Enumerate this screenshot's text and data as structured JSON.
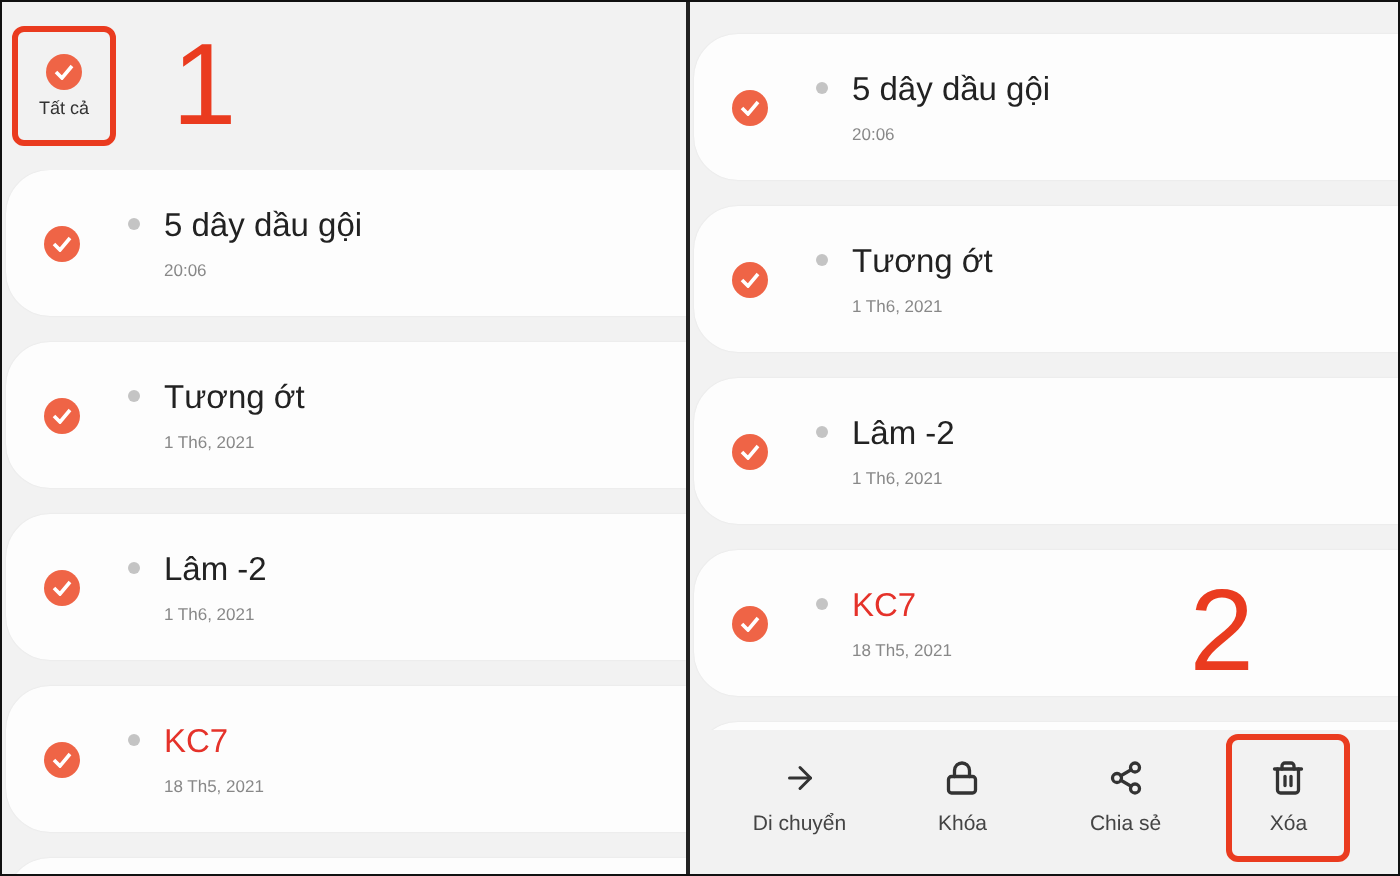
{
  "left_panel": {
    "select_all": {
      "label": "Tất cả",
      "checked": true
    },
    "step_label": "1",
    "notes": [
      {
        "title": "5 dây dầu gội",
        "date": "20:06",
        "selected": true,
        "color": "#222222"
      },
      {
        "title": "Tương ớt",
        "date": "1 Th6, 2021",
        "selected": true,
        "color": "#222222"
      },
      {
        "title": "Lâm -2",
        "date": "1 Th6, 2021",
        "selected": true,
        "color": "#222222"
      },
      {
        "title": "KC7",
        "date": "18 Th5, 2021",
        "selected": true,
        "color": "#e5322a"
      }
    ]
  },
  "right_panel": {
    "step_label": "2",
    "notes": [
      {
        "title": "5 dây dầu gội",
        "date": "20:06",
        "selected": true,
        "color": "#222222"
      },
      {
        "title": "Tương ớt",
        "date": "1 Th6, 2021",
        "selected": true,
        "color": "#222222"
      },
      {
        "title": "Lâm -2",
        "date": "1 Th6, 2021",
        "selected": true,
        "color": "#222222"
      },
      {
        "title": "KC7",
        "date": "18 Th5, 2021",
        "selected": true,
        "color": "#e5322a"
      }
    ],
    "actions": [
      {
        "kind": "move",
        "label": "Di chuyển",
        "highlighted": false
      },
      {
        "kind": "lock",
        "label": "Khóa",
        "highlighted": false
      },
      {
        "kind": "share",
        "label": "Chia sẻ",
        "highlighted": false
      },
      {
        "kind": "delete",
        "label": "Xóa",
        "highlighted": true
      }
    ]
  }
}
